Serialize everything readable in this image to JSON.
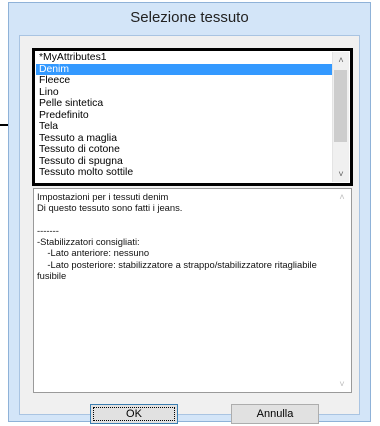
{
  "window": {
    "title": "Selezione tessuto"
  },
  "fabric_list": {
    "items": [
      "*MyAttributes1",
      "Denim",
      "Fleece",
      "Lino",
      "Pelle sintetica",
      "Predefinito",
      "Tela",
      "Tessuto a maglia",
      "Tessuto di cotone",
      "Tessuto di spugna",
      "Tessuto molto sottile"
    ],
    "selected": "Denim"
  },
  "description": {
    "lines": [
      "Impostazioni per i tessuti denim",
      "Di questo tessuto sono fatti i jeans.",
      "",
      "-------",
      "-Stabilizzatori consigliati:",
      "  -Lato anteriore: nessuno",
      "  -Lato posteriore: stabilizzatore a strappo/stabilizzatore ritagliabile",
      "fusibile"
    ]
  },
  "buttons": {
    "ok": "OK",
    "cancel": "Annulla"
  },
  "icons": {
    "scroll_up": "chevron-up-icon",
    "scroll_down": "chevron-down-icon"
  }
}
